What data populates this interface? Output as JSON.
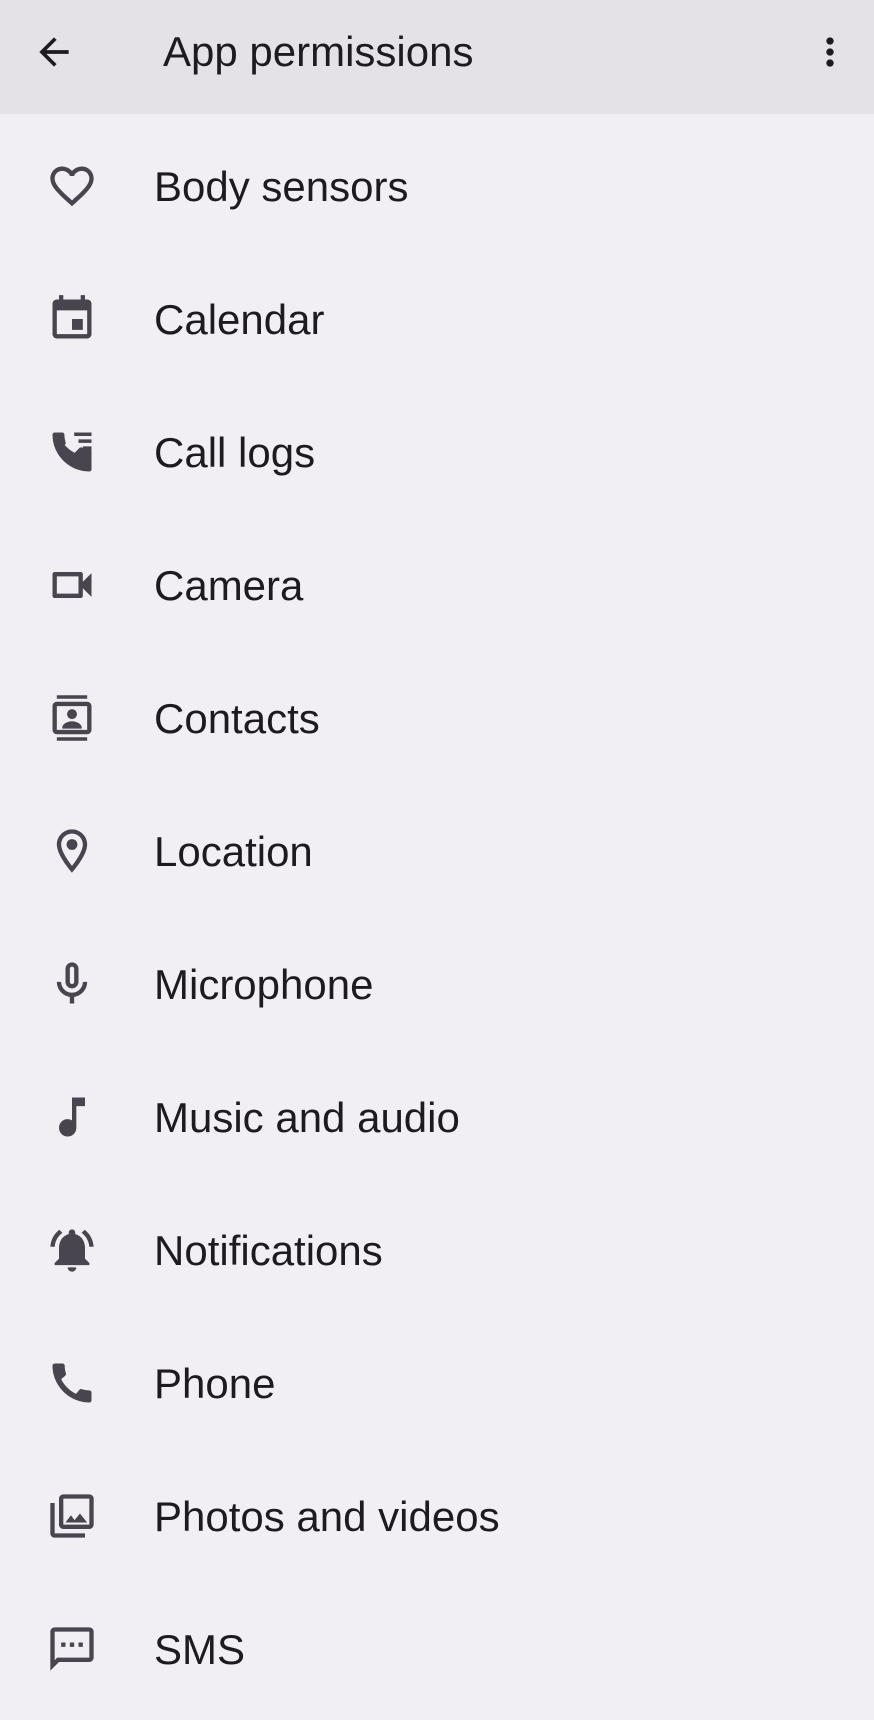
{
  "app_bar": {
    "title": "App permissions",
    "back_icon": "arrow-back-icon",
    "overflow_icon": "more-vert-icon"
  },
  "permissions": [
    {
      "label": "Body sensors",
      "icon": "heart-icon"
    },
    {
      "label": "Calendar",
      "icon": "calendar-icon"
    },
    {
      "label": "Call logs",
      "icon": "call-log-icon"
    },
    {
      "label": "Camera",
      "icon": "videocam-icon"
    },
    {
      "label": "Contacts",
      "icon": "contacts-icon"
    },
    {
      "label": "Location",
      "icon": "location-pin-icon"
    },
    {
      "label": "Microphone",
      "icon": "mic-icon"
    },
    {
      "label": "Music and audio",
      "icon": "music-note-icon"
    },
    {
      "label": "Notifications",
      "icon": "notifications-active-icon"
    },
    {
      "label": "Phone",
      "icon": "phone-icon"
    },
    {
      "label": "Photos and videos",
      "icon": "photo-library-icon"
    },
    {
      "label": "SMS",
      "icon": "sms-icon"
    }
  ],
  "colors": {
    "app_bar_bg": "#e4e2e7",
    "page_bg": "#f1eff4",
    "icon": "#49454f",
    "text": "#1d1b20"
  }
}
